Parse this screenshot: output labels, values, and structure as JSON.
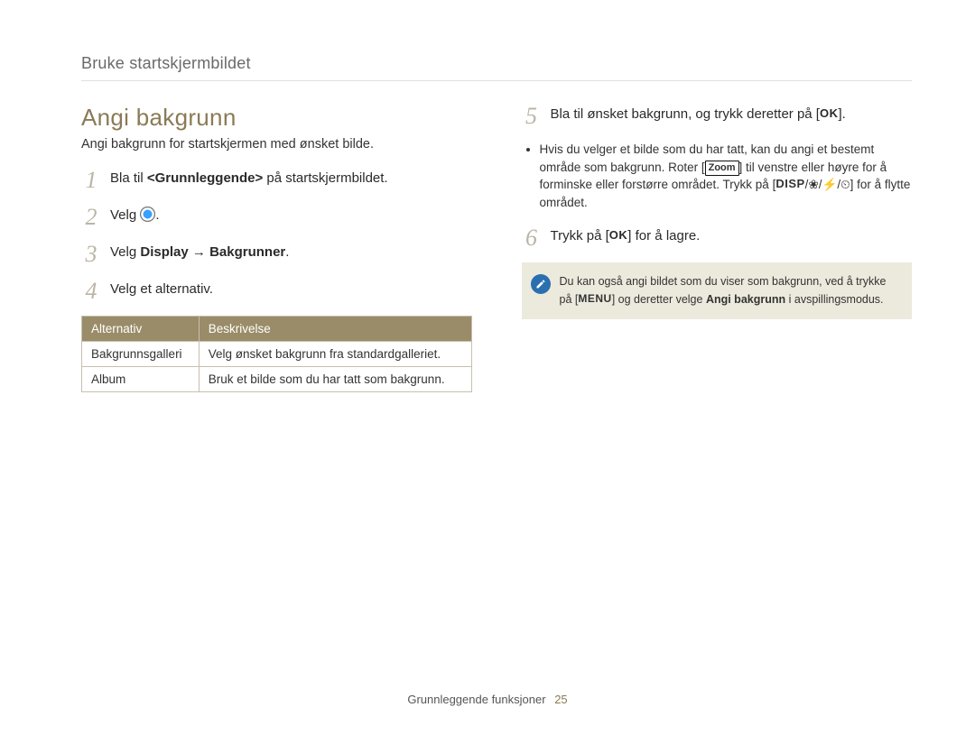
{
  "breadcrumb": "Bruke startskjermbildet",
  "section_title": "Angi bakgrunn",
  "intro": "Angi bakgrunn for startskjermen med ønsket bilde.",
  "steps_left": {
    "s1": {
      "num": "1",
      "pre": "Bla til ",
      "bold": "<Grunnleggende>",
      "post": " på startskjermbildet."
    },
    "s2": {
      "num": "2",
      "pre": "Velg ",
      "post": "."
    },
    "s3": {
      "num": "3",
      "pre": "Velg ",
      "bold1": "Display",
      "arrow": " → ",
      "bold2": "Bakgrunner",
      "post": "."
    },
    "s4": {
      "num": "4",
      "text": "Velg et alternativ."
    }
  },
  "table": {
    "headers": {
      "c1": "Alternativ",
      "c2": "Beskrivelse"
    },
    "rows": [
      {
        "c1": "Bakgrunnsgalleri",
        "c2": "Velg ønsket bakgrunn fra standardgalleriet."
      },
      {
        "c1": "Album",
        "c2": "Bruk et bilde som du har tatt som bakgrunn."
      }
    ]
  },
  "steps_right": {
    "s5": {
      "num": "5",
      "pre": "Bla til ønsket bakgrunn, og trykk deretter på [",
      "ok": "OK",
      "post": "]."
    },
    "s5_bullet": {
      "t1": "Hvis du velger et bilde som du har tatt, kan du angi et bestemt område som bakgrunn. Roter [",
      "zoom": "Zoom",
      "t2": "] til venstre eller høyre for å forminske eller forstørre området. Trykk på [",
      "disp": "DISP",
      "sep": "/",
      "flower": "❀",
      "bolt": "⚡",
      "timer": "⏲",
      "t3": "] for å flytte området."
    },
    "s6": {
      "num": "6",
      "pre": "Trykk på [",
      "ok": "OK",
      "post": "] for å lagre."
    }
  },
  "note": {
    "t1": "Du kan også angi bildet som du viser som bakgrunn, ved å trykke på [",
    "menu": "MENU",
    "t2": "] og deretter velge ",
    "bold": "Angi bakgrunn",
    "t3": " i avspillingsmodus."
  },
  "footer": {
    "label": "Grunnleggende funksjoner",
    "page": "25"
  }
}
